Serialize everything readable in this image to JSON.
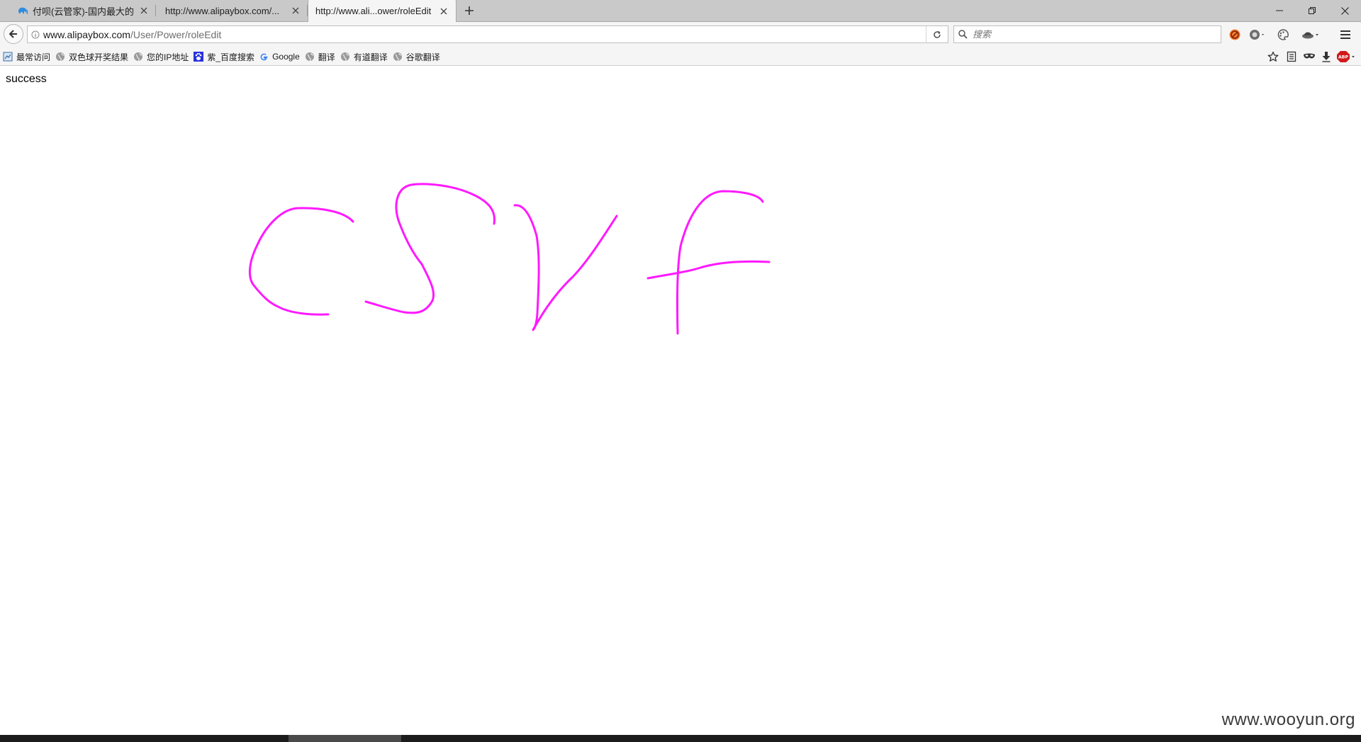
{
  "browser": {
    "tabs": [
      {
        "title": "付呗(云管家)-国内最大的...",
        "active": false,
        "icon": "elephant-favicon-icon"
      },
      {
        "title": "http://www.alipaybox.com/...",
        "active": false,
        "icon": null
      },
      {
        "title": "http://www.ali...ower/roleEdit",
        "active": true,
        "icon": null
      }
    ],
    "address_bar": {
      "host": "www.alipaybox.com",
      "path": "/User/Power/roleEdit"
    },
    "search": {
      "placeholder": "搜索"
    },
    "bookmarks": [
      {
        "label": "最常访问",
        "icon": "bookmark-folder-icon"
      },
      {
        "label": "双色球开奖结果",
        "icon": "globe-icon"
      },
      {
        "label": "您的IP地址",
        "icon": "globe-icon"
      },
      {
        "label": "紫_百度搜索",
        "icon": "baidu-paw-icon"
      },
      {
        "label": "Google",
        "icon": "google-g-icon"
      },
      {
        "label": "翻译",
        "icon": "globe-icon"
      },
      {
        "label": "有道翻译",
        "icon": "globe-icon"
      },
      {
        "label": "谷歌翻译",
        "icon": "globe-icon"
      }
    ],
    "colors": {
      "tabstrip": "#c9c9c9",
      "toolbar": "#f5f5f5",
      "ink": "#ff19ff"
    }
  },
  "page": {
    "response_text": "success",
    "handwriting_text": "csvf",
    "watermark": "www.wooyun.org"
  }
}
